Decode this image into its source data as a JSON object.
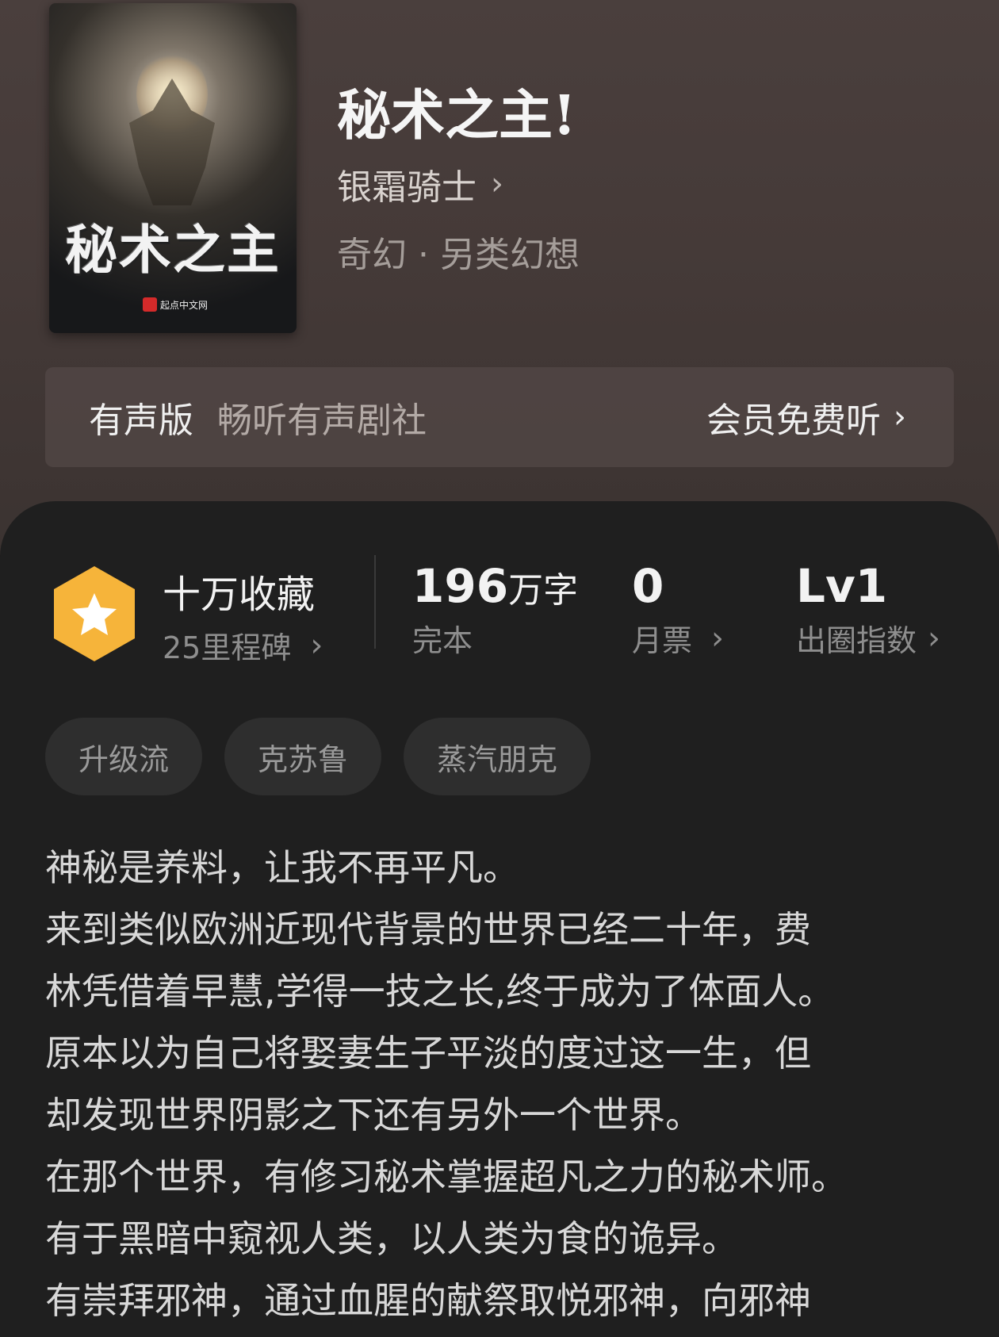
{
  "book": {
    "title": "秘术之主!",
    "author": "银霜骑士",
    "genre": "奇幻 · 另类幻想",
    "cover_title": "秘术之主",
    "cover_publisher": "起点中文网"
  },
  "audio": {
    "label": "有声版",
    "troupe": "畅听有声剧社",
    "cta": "会员免费听"
  },
  "stats": {
    "collection_title": "十万收藏",
    "collection_sub": "25里程碑",
    "words_num": "196",
    "words_unit": "万字",
    "status": "完本",
    "monthly_tickets": "0",
    "monthly_label": "月票",
    "level": "Lv1",
    "level_label": "出圈指数"
  },
  "tags": [
    "升级流",
    "克苏鲁",
    "蒸汽朋克"
  ],
  "synopsis": [
    "神秘是养料，让我不再平凡。",
    "来到类似欧洲近现代背景的世界已经二十年，费",
    "林凭借着早慧,学得一技之长,终于成为了体面人。",
    "原本以为自己将娶妻生子平淡的度过这一生，但",
    "却发现世界阴影之下还有另外一个世界。",
    "在那个世界，有修习秘术掌握超凡之力的秘术师。",
    "有于黑暗中窥视人类，以人类为食的诡异。",
    "有崇拜邪神，通过血腥的献祭取悦邪神，向邪神"
  ],
  "colors": {
    "badge": "#f6b43a",
    "header_bg": "#453a38",
    "sheet_bg": "#1f1f1f"
  },
  "icons": {
    "badge": "star-hexagon-icon",
    "chevron": "chevron-right-icon"
  }
}
